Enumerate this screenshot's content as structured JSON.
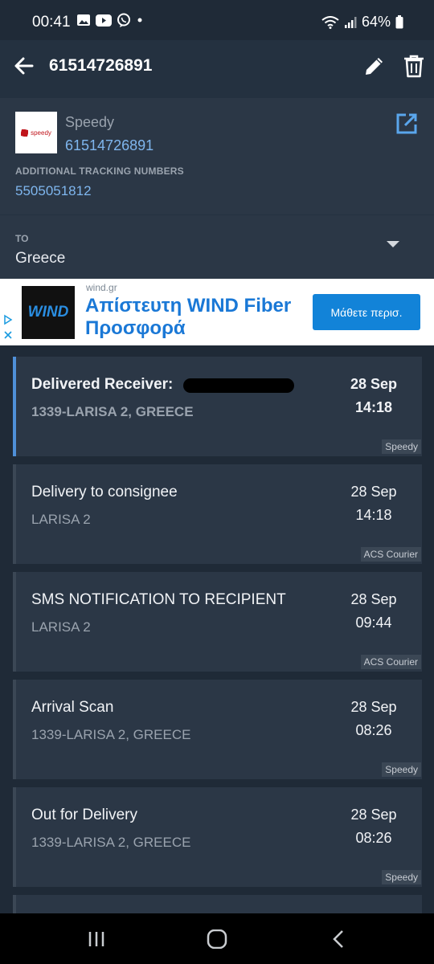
{
  "status_bar": {
    "time": "00:41",
    "battery": "64%",
    "icons": [
      "gallery-icon",
      "youtube-icon",
      "viber-icon",
      "dot-icon",
      "wifi-icon",
      "signal-icon",
      "battery-icon"
    ]
  },
  "app_bar": {
    "title": "61514726891",
    "icons": [
      "back-arrow-icon",
      "edit-pencil-icon",
      "trash-icon"
    ]
  },
  "shipment": {
    "carrier_logo_text": "speedy",
    "carrier_name": "Speedy",
    "tracking_number": "61514726891",
    "additional_label": "ADDITIONAL TRACKING NUMBERS",
    "additional_number": "5505051812",
    "to_label": "TO",
    "to_value": "Greece"
  },
  "ad": {
    "logo_text": "WIND",
    "domain": "wind.gr",
    "headline": "Απίστευτη WIND Fiber Προσφορά",
    "cta": "Μάθετε περισ."
  },
  "events": [
    {
      "title": "Delivered Receiver:",
      "location": "1339-LARISA 2, GREECE",
      "date": "28 Sep",
      "time": "14:18",
      "carrier": "Speedy",
      "active": true
    },
    {
      "title": "Delivery to consignee",
      "location": "LARISA 2",
      "date": "28 Sep",
      "time": "14:18",
      "carrier": "ACS Courier",
      "active": false
    },
    {
      "title": "SMS NOTIFICATION TO RECIPIENT",
      "location": "LARISA 2",
      "date": "28 Sep",
      "time": "09:44",
      "carrier": "ACS Courier",
      "active": false
    },
    {
      "title": "Arrival Scan",
      "location": "1339-LARISA 2, GREECE",
      "date": "28 Sep",
      "time": "08:26",
      "carrier": "Speedy",
      "active": false
    },
    {
      "title": "Out for Delivery",
      "location": "1339-LARISA 2, GREECE",
      "date": "28 Sep",
      "time": "08:26",
      "carrier": "Speedy",
      "active": false
    }
  ],
  "colors": {
    "background": "#1f2a37",
    "card": "#2b3746",
    "link": "#7fb6ee",
    "accent": "#4f90d8"
  }
}
